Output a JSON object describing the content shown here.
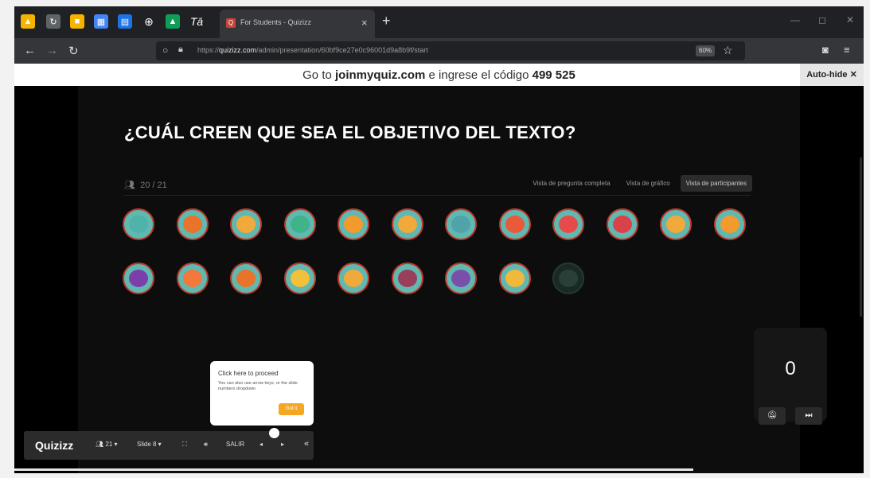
{
  "browser": {
    "tab_title": "For Students - Quizizz",
    "url_prefix": "https://",
    "url_domain": "quizizz.com",
    "url_path": "/admin/presentation/60bf9ce27e0c96001d9a8b9f/start",
    "zoom": "60%",
    "pinned_tabs": [
      "drive-icon",
      "app-icon",
      "slides-icon",
      "calendar-icon",
      "docs-icon",
      "globe-icon",
      "classroom-icon",
      "text-icon"
    ]
  },
  "banner": {
    "prefix": "Go to",
    "site": "joinmyquiz.com",
    "middle": "e ingrese el código",
    "code": "499 525",
    "autohide_label": "Auto-hide ✕"
  },
  "main": {
    "question": "¿CUÁL CREEN QUE SEA EL OBJETIVO DEL TEXTO?",
    "participant_count": "20 / 21",
    "views": [
      "Vista de pregunta completa",
      "Vista de gráfico",
      "Vista de participantes"
    ],
    "active_view_index": 2,
    "avatars": [
      {
        "color": "#4fb3a9",
        "state": "answered"
      },
      {
        "color": "#e8742b",
        "state": "answered"
      },
      {
        "color": "#f2a93b",
        "state": "answered"
      },
      {
        "color": "#3fb38a",
        "state": "answered"
      },
      {
        "color": "#f29a2e",
        "state": "answered"
      },
      {
        "color": "#f2a93b",
        "state": "answered"
      },
      {
        "color": "#4fa3a9",
        "state": "answered"
      },
      {
        "color": "#e85a3a",
        "state": "answered"
      },
      {
        "color": "#e84a4a",
        "state": "answered"
      },
      {
        "color": "#d9424a",
        "state": "answered"
      },
      {
        "color": "#f2a93b",
        "state": "answered"
      },
      {
        "color": "#f29a2e",
        "state": "answered"
      },
      {
        "color": "#7a3fa9",
        "state": "answered"
      },
      {
        "color": "#f2783b",
        "state": "answered"
      },
      {
        "color": "#e8742b",
        "state": "answered"
      },
      {
        "color": "#f2c03b",
        "state": "answered"
      },
      {
        "color": "#f2a93b",
        "state": "answered"
      },
      {
        "color": "#9a3f5a",
        "state": "answered"
      },
      {
        "color": "#7a4fa9",
        "state": "answered"
      },
      {
        "color": "#f2b83b",
        "state": "answered"
      },
      {
        "color": "#2f4a40",
        "state": "pending"
      }
    ]
  },
  "tooltip": {
    "title": "Click here to proceed",
    "body": "You can also use arrow keys, or the slide numbers dropdown",
    "button": "Got it"
  },
  "toolbar": {
    "logo": "Quizizz",
    "participants": "21 ▾",
    "slide": "Slide 8 ▾",
    "exit": "SALIR"
  },
  "counter": {
    "value": "0"
  },
  "colors": {
    "accent": "#f5a623",
    "stage_bg": "#0d0d0d"
  }
}
